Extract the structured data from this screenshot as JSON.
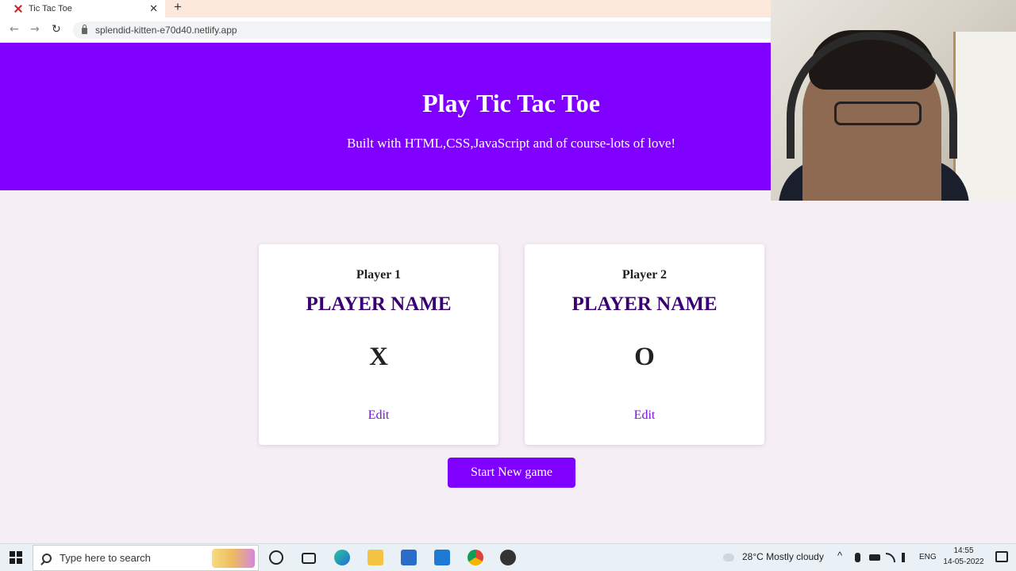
{
  "browser": {
    "tab_title": "Tic Tac Toe",
    "tab_close": "✕",
    "new_tab": "+",
    "url": "splendid-kitten-e70d40.netlify.app",
    "back": "←",
    "forward": "→",
    "reload": "↻"
  },
  "header": {
    "title": "Play Tic Tac Toe",
    "subtitle": "Built with HTML,CSS,JavaScript and of course-lots of love!"
  },
  "players": [
    {
      "label": "Player 1",
      "name": "PLAYER NAME",
      "symbol": "X",
      "edit_label": "Edit"
    },
    {
      "label": "Player 2",
      "name": "PLAYER NAME",
      "symbol": "O",
      "edit_label": "Edit"
    }
  ],
  "start_button": "Start New game",
  "taskbar": {
    "search_placeholder": "Type here to search",
    "weather": "28°C  Mostly cloudy",
    "language": "ENG",
    "time": "14:55",
    "date": "14-05-2022"
  },
  "colors": {
    "accent": "#8000ff",
    "player_name": "#3a0072",
    "page_bg": "#f5eff5"
  }
}
